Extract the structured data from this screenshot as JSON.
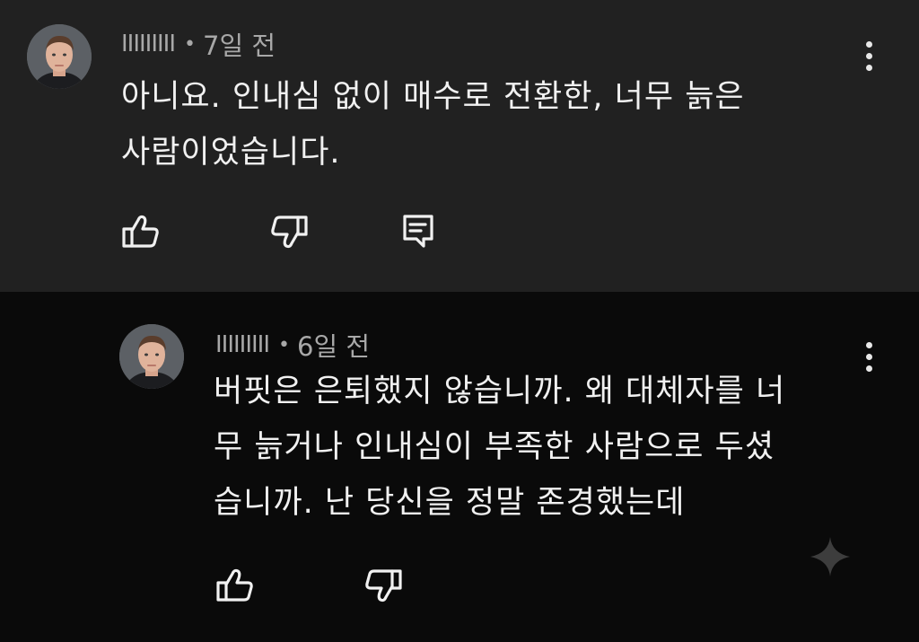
{
  "comments": [
    {
      "author": "IIIIIIIII",
      "separator": "•",
      "time": "7일 전",
      "lines": [
        "아니요. 인내심 없이 매수로 전환한, 너무 늙은",
        "사람이었습니다."
      ]
    },
    {
      "author": "IIIIIIIII",
      "separator": "•",
      "time": "6일 전",
      "lines": [
        "버핏은 은퇴했지 않습니까. 왜 대체자를 너",
        "무 늙거나 인내심이 부족한 사람으로 두셨",
        "습니까. 난 당신을 정말 존경했는데"
      ]
    }
  ],
  "icons": {
    "like": "thumbs-up-icon",
    "dislike": "thumbs-down-icon",
    "reply": "reply-icon",
    "more": "more-vert-icon",
    "ai": "sparkle-icon"
  },
  "colors": {
    "top_comment_bg": "#212121",
    "reply_bg": "#0a0a0a",
    "text": "#f1f1f1",
    "meta": "#a8a8a8"
  }
}
